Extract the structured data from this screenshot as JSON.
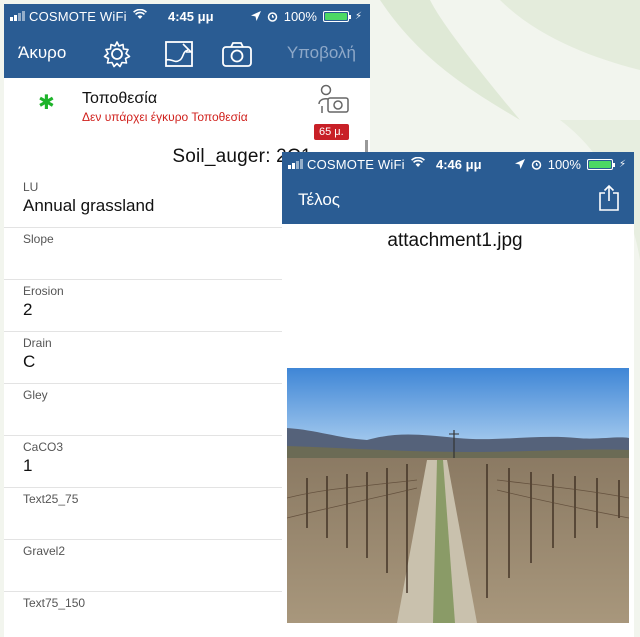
{
  "screen1": {
    "status": {
      "carrier": "COSMOTE WiFi",
      "time": "4:45 μμ",
      "battery": "100%"
    },
    "toolbar": {
      "cancel_label": "Άκυρο",
      "submit_label": "Υποβολή"
    },
    "location": {
      "title": "Τοποθεσία",
      "subtitle": "Δεν υπάρχει έγκυρο Τοποθεσία",
      "distance": "65 μ."
    },
    "form_title": "Soil_auger: 2C1",
    "fields": [
      {
        "label": "LU",
        "value": "Annual grassland"
      },
      {
        "label": "Slope",
        "value": ""
      },
      {
        "label": "Erosion",
        "value": "2"
      },
      {
        "label": "Drain",
        "value": "C"
      },
      {
        "label": "Gley",
        "value": ""
      },
      {
        "label": "CaCO3",
        "value": "1"
      },
      {
        "label": "Text25_75",
        "value": ""
      },
      {
        "label": "Gravel2",
        "value": ""
      },
      {
        "label": "Text75_150",
        "value": ""
      }
    ]
  },
  "screen2": {
    "status": {
      "carrier": "COSMOTE WiFi",
      "time": "4:46 μμ",
      "battery": "100%"
    },
    "toolbar": {
      "done_label": "Τέλος"
    },
    "attachment_title": "attachment1.jpg"
  },
  "colors": {
    "navbar": "#2a5c93",
    "accent_green": "#1db32a",
    "alert_red": "#c82027"
  },
  "icons": [
    "gear-icon",
    "map-edit-icon",
    "camera-icon",
    "geotag-photo-icon",
    "share-icon",
    "wifi-icon",
    "location-arrow-icon",
    "alarm-icon",
    "battery-icon"
  ]
}
